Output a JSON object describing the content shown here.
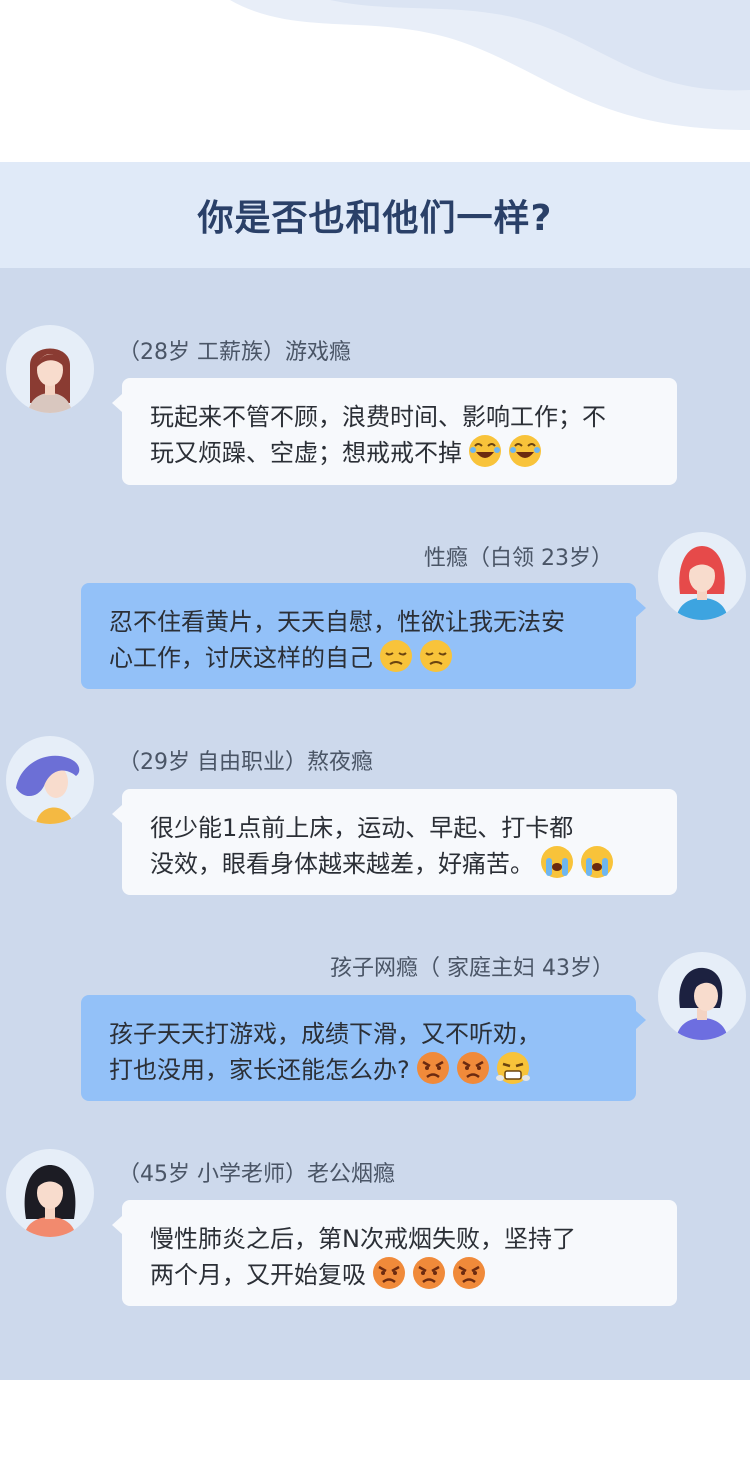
{
  "header": {
    "title": "你是否也和他们一样?"
  },
  "colors": {
    "header_bg": "#e0eaf8",
    "chat_bg": "#cdd9ec",
    "bubble_left": "#f7f9fc",
    "bubble_right": "#93c1f8",
    "title": "#2a4068"
  },
  "messages": [
    {
      "side": "left",
      "avatar_icon": "woman-long-brown-hair-icon",
      "label": "（28岁  工薪族）游戏瘾",
      "lines": [
        "玩起来不管不顾，浪费时间、影响工作；不",
        "玩又烦躁、空虚；想戒戒不掉"
      ],
      "emojis": [
        "laughing-tears-emoji-icon",
        "laughing-tears-emoji-icon"
      ]
    },
    {
      "side": "right",
      "avatar_icon": "woman-red-hair-icon",
      "label": "性瘾（白领   23岁）",
      "lines": [
        "忍不住看黄片，天天自慰，性欲让我无法安",
        "心工作，讨厌这样的自己"
      ],
      "emojis": [
        "pensive-face-emoji-icon",
        "pensive-face-emoji-icon"
      ]
    },
    {
      "side": "left",
      "avatar_icon": "woman-purple-hair-icon",
      "label": "（29岁  自由职业）熬夜瘾",
      "lines": [
        "很少能1点前上床，运动、早起、打卡都",
        "没效，眼看身体越来越差，好痛苦。"
      ],
      "emojis": [
        "loudly-crying-emoji-icon",
        "loudly-crying-emoji-icon"
      ]
    },
    {
      "side": "right",
      "avatar_icon": "woman-bob-hair-icon",
      "label": "孩子网瘾（ 家庭主妇  43岁）",
      "lines": [
        "孩子天天打游戏，成绩下滑，又不听劝，",
        "打也没用，家长还能怎么办?"
      ],
      "emojis": [
        "angry-face-emoji-icon",
        "angry-face-emoji-icon",
        "steam-face-emoji-icon"
      ]
    },
    {
      "side": "left",
      "avatar_icon": "woman-black-hair-icon",
      "label": "（45岁  小学老师）老公烟瘾",
      "lines": [
        "慢性肺炎之后，第N次戒烟失败，坚持了",
        "两个月，又开始复吸"
      ],
      "emojis": [
        "angry-face-emoji-icon",
        "angry-face-emoji-icon",
        "angry-face-emoji-icon"
      ]
    }
  ]
}
